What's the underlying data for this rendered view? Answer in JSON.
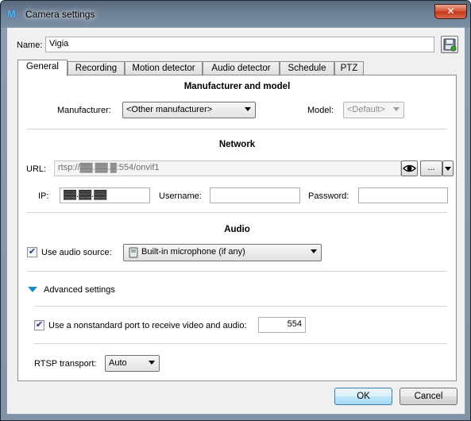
{
  "window": {
    "title": "Camera settings",
    "close_glyph": "✕",
    "app_icon_glyph": "M"
  },
  "name": {
    "label": "Name:",
    "value": "Vigia"
  },
  "tabs": [
    {
      "label": "General",
      "active": true
    },
    {
      "label": "Recording"
    },
    {
      "label": "Motion detector"
    },
    {
      "label": "Audio detector"
    },
    {
      "label": "Schedule"
    },
    {
      "label": "PTZ"
    }
  ],
  "manufacturer_section": {
    "title": "Manufacturer and model",
    "manufacturer_label": "Manufacturer:",
    "manufacturer_value": "<Other manufacturer>",
    "model_label": "Model:",
    "model_value": "<Default>"
  },
  "network_section": {
    "title": "Network",
    "url_label": "URL:",
    "url_value": "rtsp://▓▓.▓▓.▓:554/onvif1",
    "more_button": "...",
    "ip_label": "IP:",
    "ip_value": "▓▓.▓▓.▓▓",
    "username_label": "Username:",
    "username_value": "",
    "password_label": "Password:",
    "password_value": ""
  },
  "audio_section": {
    "title": "Audio",
    "use_audio_label": "Use audio source:",
    "use_audio_checked": true,
    "audio_source_value": "Built-in microphone (if any)"
  },
  "advanced": {
    "title": "Advanced settings",
    "nonstandard_port_label": "Use a nonstandard port to receive video and audio:",
    "nonstandard_port_checked": true,
    "port_value": "554",
    "rtsp_label": "RTSP transport:",
    "rtsp_value": "Auto"
  },
  "footer": {
    "ok": "OK",
    "cancel": "Cancel"
  },
  "colors": {
    "accent": "#1d8dbf",
    "close": "#c4381a",
    "default_button": "#3c7fb1"
  }
}
